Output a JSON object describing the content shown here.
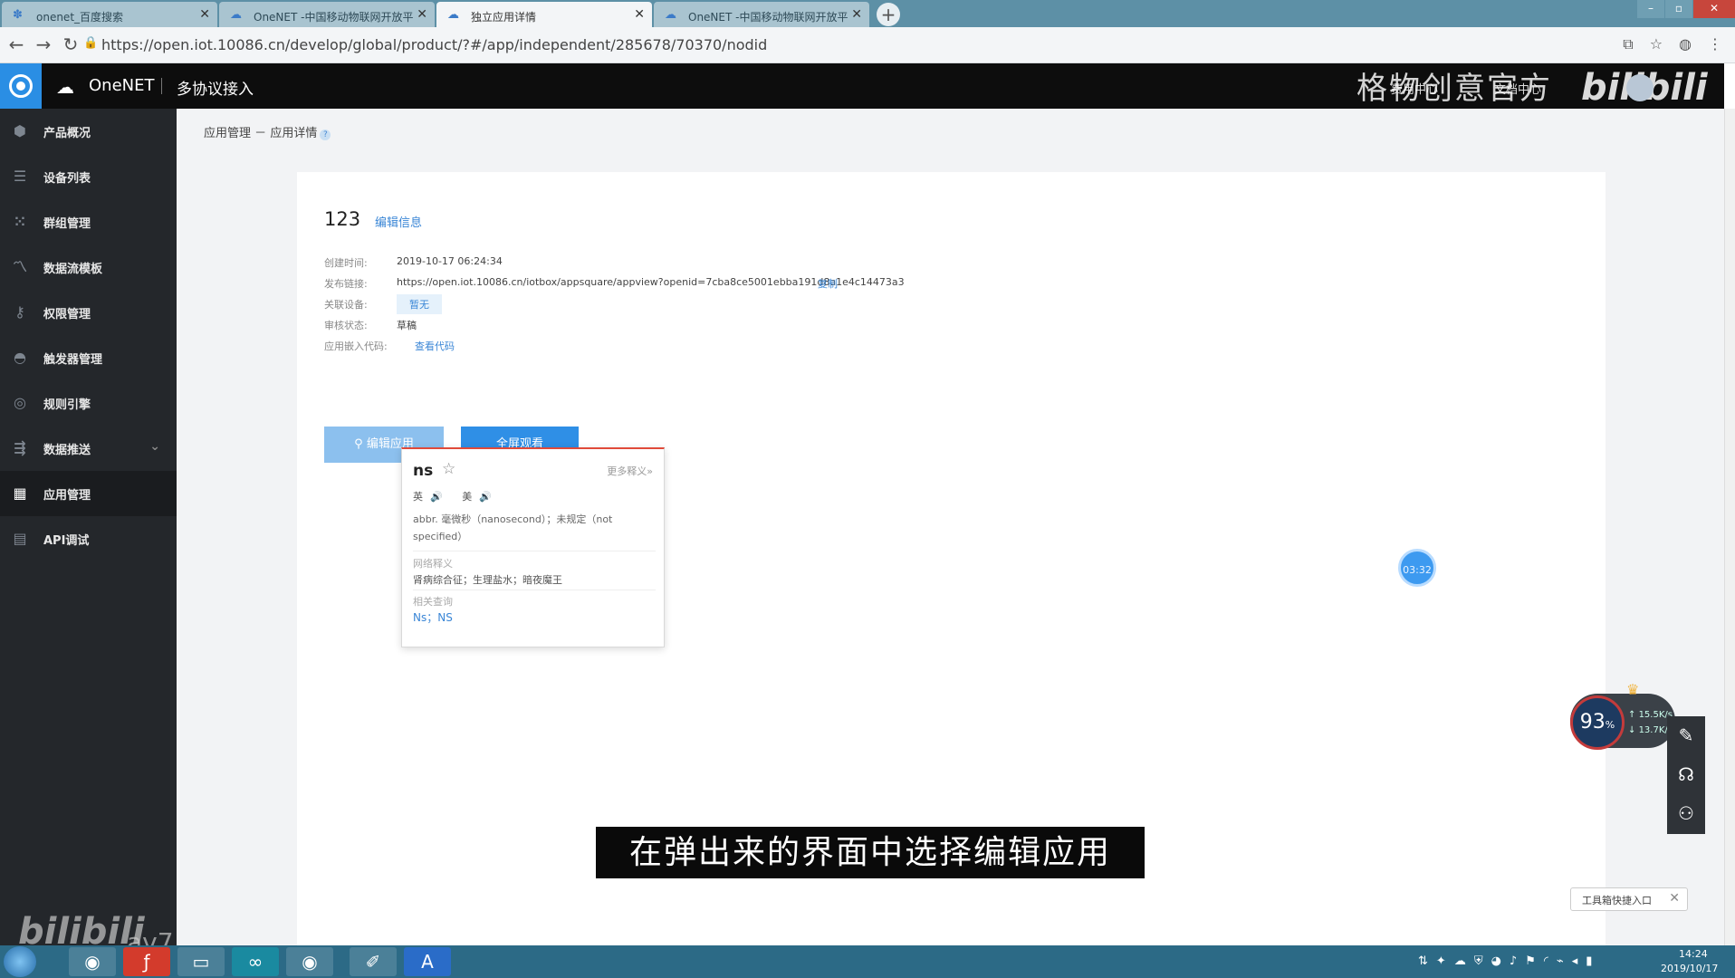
{
  "browser": {
    "tabs": [
      {
        "title": "onenet_百度搜索",
        "active": false
      },
      {
        "title": "OneNET -中国移动物联网开放平",
        "active": false
      },
      {
        "title": "独立应用详情",
        "active": true
      },
      {
        "title": "OneNET -中国移动物联网开放平",
        "active": false
      }
    ],
    "url": "https://open.iot.10086.cn/develop/global/product/?#/app/independent/285678/70370/nodid"
  },
  "header": {
    "brand": "OneNET",
    "product": "多协议接入",
    "links": [
      "费用中心",
      "文档中心"
    ],
    "watermark": "格物创意官方",
    "bili_logo": "bilibili"
  },
  "sidebar": {
    "items": [
      {
        "label": "产品概况",
        "icon": "cube-icon"
      },
      {
        "label": "设备列表",
        "icon": "list-icon"
      },
      {
        "label": "群组管理",
        "icon": "grid-dots-icon"
      },
      {
        "label": "数据流模板",
        "icon": "wave-icon"
      },
      {
        "label": "权限管理",
        "icon": "key-icon"
      },
      {
        "label": "触发器管理",
        "icon": "trigger-icon"
      },
      {
        "label": "规则引擎",
        "icon": "engine-icon"
      },
      {
        "label": "数据推送",
        "icon": "push-icon"
      },
      {
        "label": "应用管理",
        "icon": "apps-icon",
        "active": true
      },
      {
        "label": "API调试",
        "icon": "api-icon"
      }
    ]
  },
  "breadcrumb": {
    "parent": "应用管理",
    "sep": "－",
    "current": "应用详情"
  },
  "app": {
    "name": "123",
    "edit_info": "编辑信息",
    "fields": {
      "created_label": "创建时间:",
      "created_value": "2019-10-17 06:24:34",
      "link_label": "发布链接:",
      "link_value": "https://open.iot.10086.cn/iotbox/appsquare/appview?openid=7cba8ce5001ebba191d8a1e4c14473a3",
      "copy": "复制",
      "device_label": "关联设备:",
      "device_value": "暂无",
      "status_label": "审核状态:",
      "status_value": "草稿",
      "embed_label": "应用嵌入代码:",
      "embed_value": "查看代码"
    },
    "buttons": {
      "edit": "编辑应用",
      "full": "全屏观看"
    }
  },
  "dict_popup": {
    "word": "ns",
    "more": "更多释义»",
    "uk": "英",
    "us": "美",
    "definition": "abbr. 毫微秒（nanosecond）；未规定（not specified）",
    "web_title": "网络释义",
    "web_text": "肾病综合征；生理盐水；暗夜魔王",
    "related_title": "相关查询",
    "related": "Ns；NS"
  },
  "timer": "03:32",
  "subtitle": "在弹出来的界面中选择编辑应用",
  "speed_widget": {
    "percent": "93",
    "unit": "%",
    "up": "15.5K/s",
    "down": "13.7K/s"
  },
  "shortcut": "工具箱快捷入口",
  "bili_watermark": {
    "logo": "bilibili",
    "av": "av7"
  },
  "taskbar": {
    "time": "14:24",
    "date": "2019/10/17"
  }
}
